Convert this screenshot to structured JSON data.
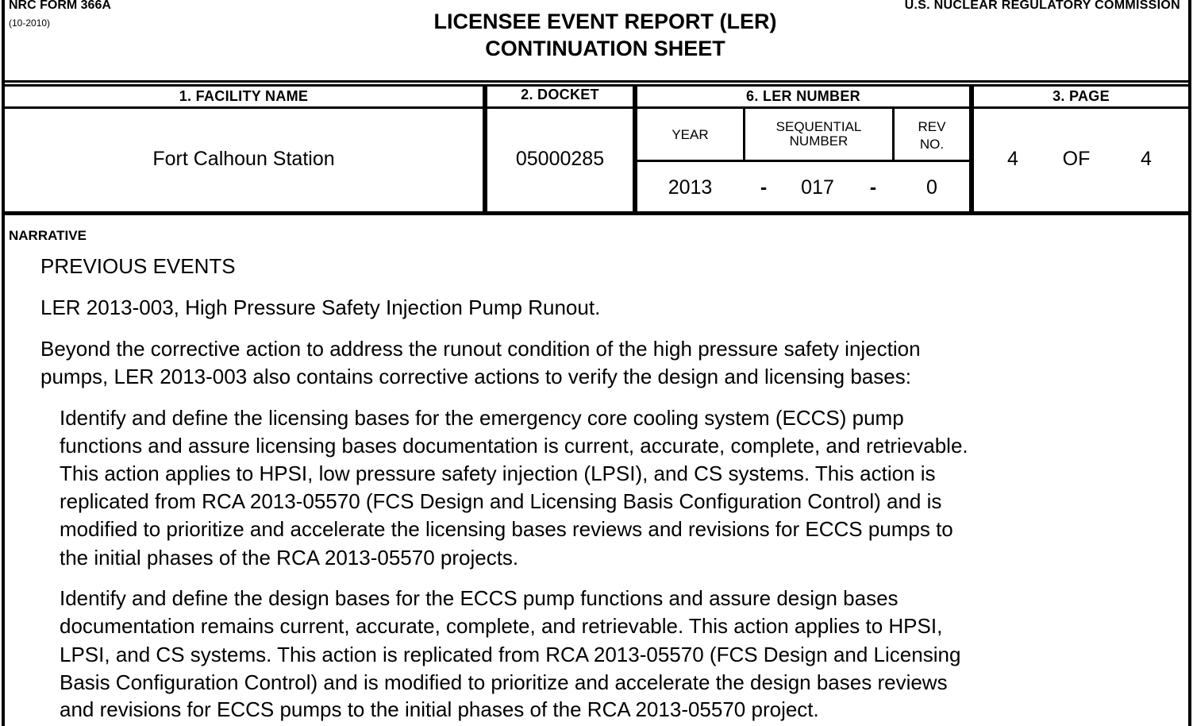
{
  "header": {
    "form_id": "NRC FORM 366A",
    "form_rev": "(10-2010)",
    "title_line1": "LICENSEE EVENT REPORT (LER)",
    "title_line2": "CONTINUATION SHEET",
    "commission": "U.S. NUCLEAR REGULATORY COMMISSION"
  },
  "table": {
    "facility_header": "1. FACILITY NAME",
    "docket_header": "2. DOCKET",
    "ler_header": "6. LER NUMBER",
    "page_header": "3. PAGE",
    "facility_name": "Fort Calhoun Station",
    "docket": "05000285",
    "year_label": "YEAR",
    "seq_label_1": "SEQUENTIAL",
    "seq_label_2": "NUMBER",
    "rev_label_1": "REV",
    "rev_label_2": "NO.",
    "year": "2013",
    "dash1": "-",
    "sequential": "017",
    "dash2": "-",
    "rev": "0",
    "page_num": "4",
    "page_of": "OF",
    "page_total": "4"
  },
  "narrative": {
    "label": "NARRATIVE",
    "heading": "PREVIOUS EVENTS",
    "ler_ref": "LER 2013-003, High Pressure Safety Injection Pump Runout.",
    "p1_l1": "Beyond the corrective action to address the runout condition of the high pressure safety injection",
    "p1_l2": "pumps, LER 2013-003 also contains corrective actions to verify the design and licensing bases:",
    "p2_l1": "Identify and define the licensing bases for the emergency core cooling system (ECCS) pump",
    "p2_l2": "functions and assure licensing bases documentation is current, accurate, complete, and retrievable.",
    "p2_l3": "This action applies to HPSI, low pressure safety injection (LPSI), and CS systems.  This action is",
    "p2_l4": "replicated from RCA 2013-05570 (FCS Design and Licensing Basis Configuration Control) and is",
    "p2_l5": "modified to prioritize and accelerate the licensing bases reviews and revisions for ECCS pumps to",
    "p2_l6": "the initial phases of the RCA 2013-05570 projects.",
    "p3_l1": "Identify and define the design bases for the ECCS pump functions and assure design bases",
    "p3_l2": "documentation remains current, accurate, complete, and retrievable.  This action applies to HPSI,",
    "p3_l3": "LPSI, and CS systems.  This action is replicated from RCA 2013-05570 (FCS Design and Licensing",
    "p3_l4": "Basis Configuration Control) and is modified to prioritize and accelerate the design bases reviews",
    "p3_l5": "and revisions for ECCS pumps to the initial phases of the RCA 2013-05570 project."
  }
}
